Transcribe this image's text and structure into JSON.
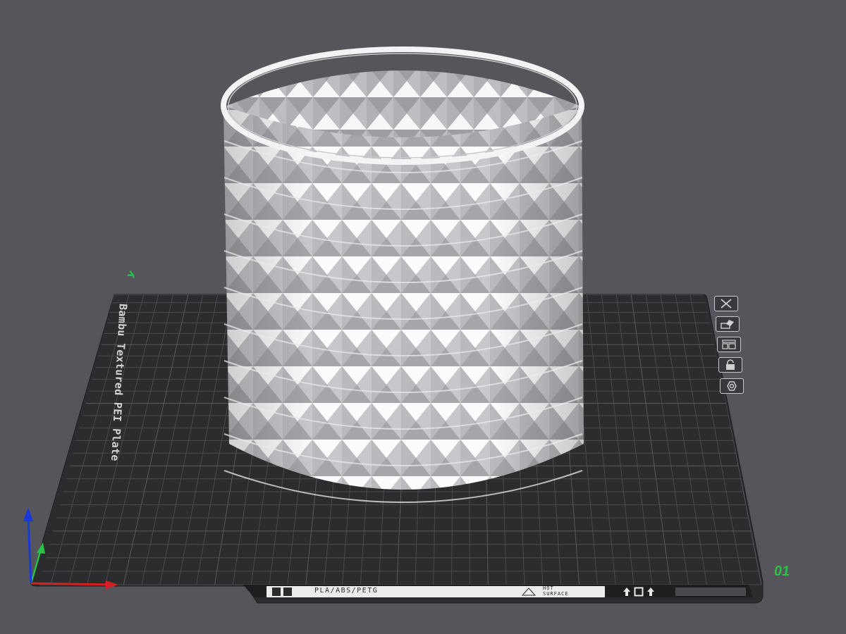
{
  "viewport": {
    "background_color": "#55555b",
    "model": {
      "name": "studded-cylinder-vase",
      "color": "#f0f0f0"
    }
  },
  "build_plate": {
    "name": "Bambu Textured PEI Plate",
    "plate_number": "01",
    "surface_color": "#2c2c2e",
    "grid_color": "#4a4a4e",
    "label_strip": {
      "material": "PLA/ABS/PETG",
      "hot_surface": "HOT\nSURFACE"
    },
    "buttons": [
      {
        "name": "close-plate",
        "icon": "close-icon"
      },
      {
        "name": "auto-arrange",
        "icon": "auto-arrange-icon"
      },
      {
        "name": "plate-settings",
        "icon": "plate-settings-icon"
      },
      {
        "name": "lock-plate",
        "icon": "lock-icon"
      },
      {
        "name": "plate-options",
        "icon": "gear-icon"
      }
    ]
  },
  "axes": {
    "x_color": "#d42020",
    "y_color": "#27c246",
    "z_color": "#1a3ad8",
    "y_label": "У"
  }
}
